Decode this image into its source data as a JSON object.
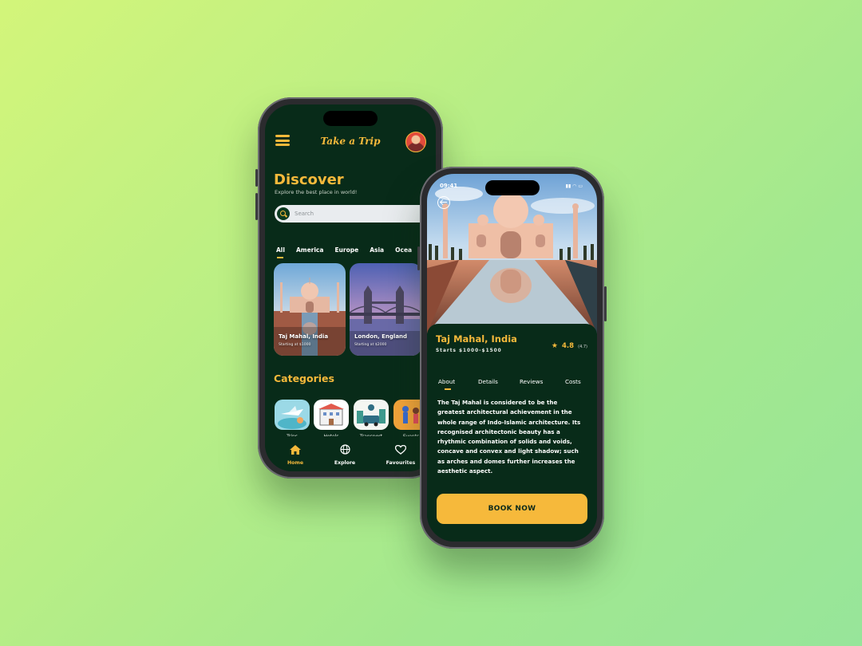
{
  "colors": {
    "accent": "#f6b93b",
    "screen_bg": "#082b19",
    "text": "#ffffff"
  },
  "left_screen": {
    "header": {
      "menu_icon": "hamburger-icon",
      "app_title": "Take a Trip",
      "avatar": "user-avatar"
    },
    "discover": {
      "title": "Discover",
      "subtitle": "Explore the best place in world!"
    },
    "search": {
      "placeholder": "Search",
      "icon": "search-icon"
    },
    "region_tabs": [
      "All",
      "America",
      "Europe",
      "Asia",
      "Oceania"
    ],
    "active_region": "All",
    "places": [
      {
        "name": "Taj Mahal, India",
        "price": "Starting at $1000"
      },
      {
        "name": "London, England",
        "price": "Starting at $2000"
      }
    ],
    "categories_title": "Categories",
    "categories": [
      "Trips",
      "Hotels",
      "Transport",
      "Events"
    ],
    "bottom_nav": [
      {
        "label": "Home",
        "icon": "home-icon",
        "active": true
      },
      {
        "label": "Explore",
        "icon": "globe-icon",
        "active": false
      },
      {
        "label": "Favourites",
        "icon": "heart-icon",
        "active": false
      }
    ]
  },
  "right_screen": {
    "status": {
      "time": "09:41"
    },
    "back_icon": "back-arrow-icon",
    "place": {
      "title": "Taj Mahal, India",
      "price_range": "Starts $1000-$1500",
      "rating": "4.8",
      "rating_count": "(4.7)"
    },
    "tabs": [
      "About",
      "Details",
      "Reviews",
      "Costs"
    ],
    "active_tab": "About",
    "about": "The Taj Mahal is considered to be the greatest architectural achievement in the whole range of Indo-Islamic architecture. Its recognised architectonic beauty has a rhythmic combination of solids and voids, concave and convex and light shadow; such as arches and domes further increases the aesthetic aspect.",
    "book_button": "BOOK NOW"
  }
}
